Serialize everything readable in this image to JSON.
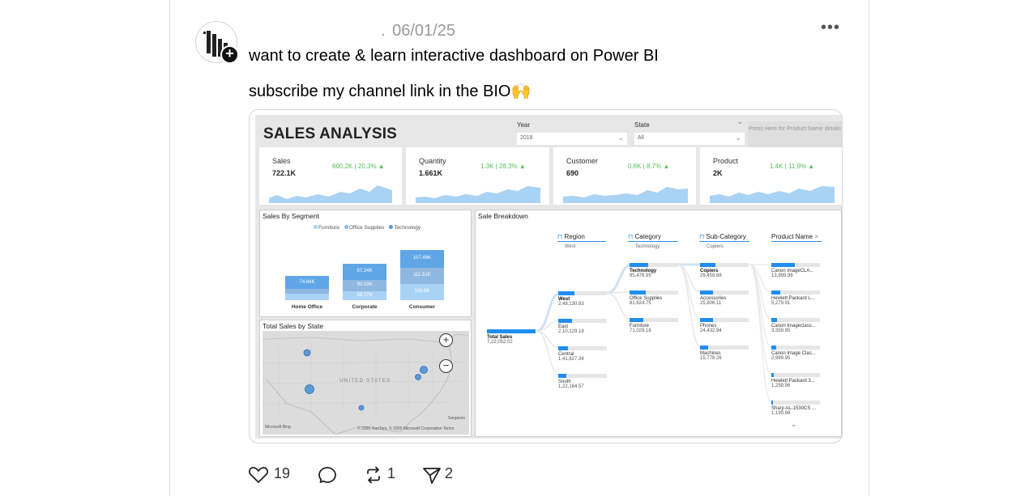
{
  "post": {
    "username": ".",
    "date": "06/01/25",
    "more_label": "•••",
    "text_line1": "want to create & learn interactive dashboard on Power BI",
    "text_line2": "subscribe my channel link in the BIO🙌"
  },
  "dashboard": {
    "title": "SALES ANALYSIS",
    "year_label": "Year",
    "year_value": "2018",
    "state_label": "State",
    "state_value": "All",
    "press_button": "Press Here for Product Name details",
    "kpis": [
      {
        "label": "Sales",
        "value": "722.1K",
        "delta": "600.2K | 20.3% ▲"
      },
      {
        "label": "Quantity",
        "value": "1.661K",
        "delta": "1.3K | 28.3% ▲"
      },
      {
        "label": "Customer",
        "value": "690",
        "delta": "0.6K | 8.7% ▲"
      },
      {
        "label": "Product",
        "value": "2K",
        "delta": "1.4K | 11.9% ▲"
      }
    ],
    "segment_chart": {
      "title": "Sales By Segment",
      "legend": [
        "Furniture",
        "Office Supplies",
        "Technology"
      ],
      "segments": [
        {
          "name": "Home Office",
          "labels": [
            "74.64K"
          ]
        },
        {
          "name": "Corporate",
          "labels": [
            "87.24K",
            "90.03K",
            "58.77K"
          ]
        },
        {
          "name": "Consumer",
          "labels": [
            "107.49K",
            "111.51K",
            "109.6K"
          ]
        }
      ]
    },
    "map": {
      "title": "Total Sales by State",
      "country_label": "UNITED STATES",
      "zoom_in": "+",
      "zoom_out": "−",
      "attribution": "© 2025 TomTom, © 2025 Microsoft Corporation  Terms",
      "bing": "Microsoft Bing",
      "corner": "Sargasso"
    },
    "breakdown": {
      "title": "Sale Breakdown",
      "columns": [
        {
          "head": "Region",
          "sub": "West"
        },
        {
          "head": "Category",
          "sub": "Technology"
        },
        {
          "head": "Sub-Category",
          "sub": "Copiers"
        },
        {
          "head": "Product Name",
          "sub": ""
        }
      ],
      "total": {
        "name": "Total Sales",
        "value": "7,22,052.02"
      },
      "regions": [
        {
          "name": "West",
          "value": "2,48,130.93"
        },
        {
          "name": "East",
          "value": "2,10,129.19"
        },
        {
          "name": "Central",
          "value": "1,41,627.34"
        },
        {
          "name": "South",
          "value": "1,22,164.57"
        }
      ],
      "categories": [
        {
          "name": "Technology",
          "value": "95,476.99"
        },
        {
          "name": "Office Supplies",
          "value": "81,624.75"
        },
        {
          "name": "Furniture",
          "value": "71,029.18"
        }
      ],
      "subcategories": [
        {
          "name": "Copiers",
          "value": "29,459.68"
        },
        {
          "name": "Accessories",
          "value": "25,806.11"
        },
        {
          "name": "Phones",
          "value": "24,432.94"
        },
        {
          "name": "Machines",
          "value": "15,778.26"
        }
      ],
      "products": [
        {
          "name": "Canon imageCLA...",
          "value": "13,999.96"
        },
        {
          "name": "Hewlett Packard L...",
          "value": "5,279.91"
        },
        {
          "name": "Canon Imageclass...",
          "value": "3,359.95"
        },
        {
          "name": "Canon Image Clas...",
          "value": "2,999.95"
        },
        {
          "name": "Hewlett Packard 3...",
          "value": "1,259.96"
        },
        {
          "name": "Sharp AL-1530CS ...",
          "value": "1,199.98"
        }
      ]
    }
  },
  "actions": {
    "likes": "19",
    "reposts": "1",
    "shares": "2"
  },
  "colors": {
    "accent_blue": "#1f8ef0",
    "kpi_green": "#57c05a",
    "spark_blue": "#a9d3f5"
  }
}
